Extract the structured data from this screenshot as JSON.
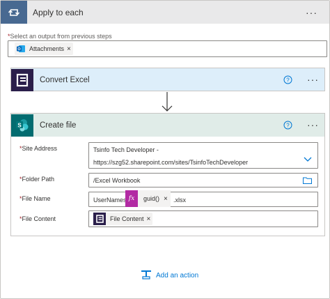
{
  "apply_each": {
    "title": "Apply to each",
    "select_label": "Select an output from previous steps",
    "token_label": "Attachments",
    "token_remove": "×"
  },
  "convert_excel": {
    "title": "Convert Excel"
  },
  "create_file": {
    "title": "Create file",
    "site_address_label": "Site Address",
    "site_address_line1": "Tsinfo Tech Developer -",
    "site_address_line2": "https://szg52.sharepoint.com/sites/TsinfoTechDeveloper",
    "folder_path_label": "Folder Path",
    "folder_path_value": "/Excel Workbook",
    "file_name_label": "File Name",
    "file_name_prefix": "UserNames",
    "file_name_expr_token": "guid()",
    "file_name_suffix": ".xlsx",
    "file_content_label": "File Content",
    "file_content_token": "File Content",
    "token_remove": "×"
  },
  "common": {
    "more_dots": "···",
    "required_star": "*",
    "fx_symbol": "fx"
  },
  "add_action": {
    "label": "Add an action"
  },
  "colors": {
    "loop_header_icon_bg": "#486991",
    "convert_header_bg": "#ddeefa",
    "create_header_bg": "#e0ece8",
    "sharepoint": "#036c70",
    "expression_purple": "#b22aa3",
    "link_blue": "#0078d4"
  }
}
